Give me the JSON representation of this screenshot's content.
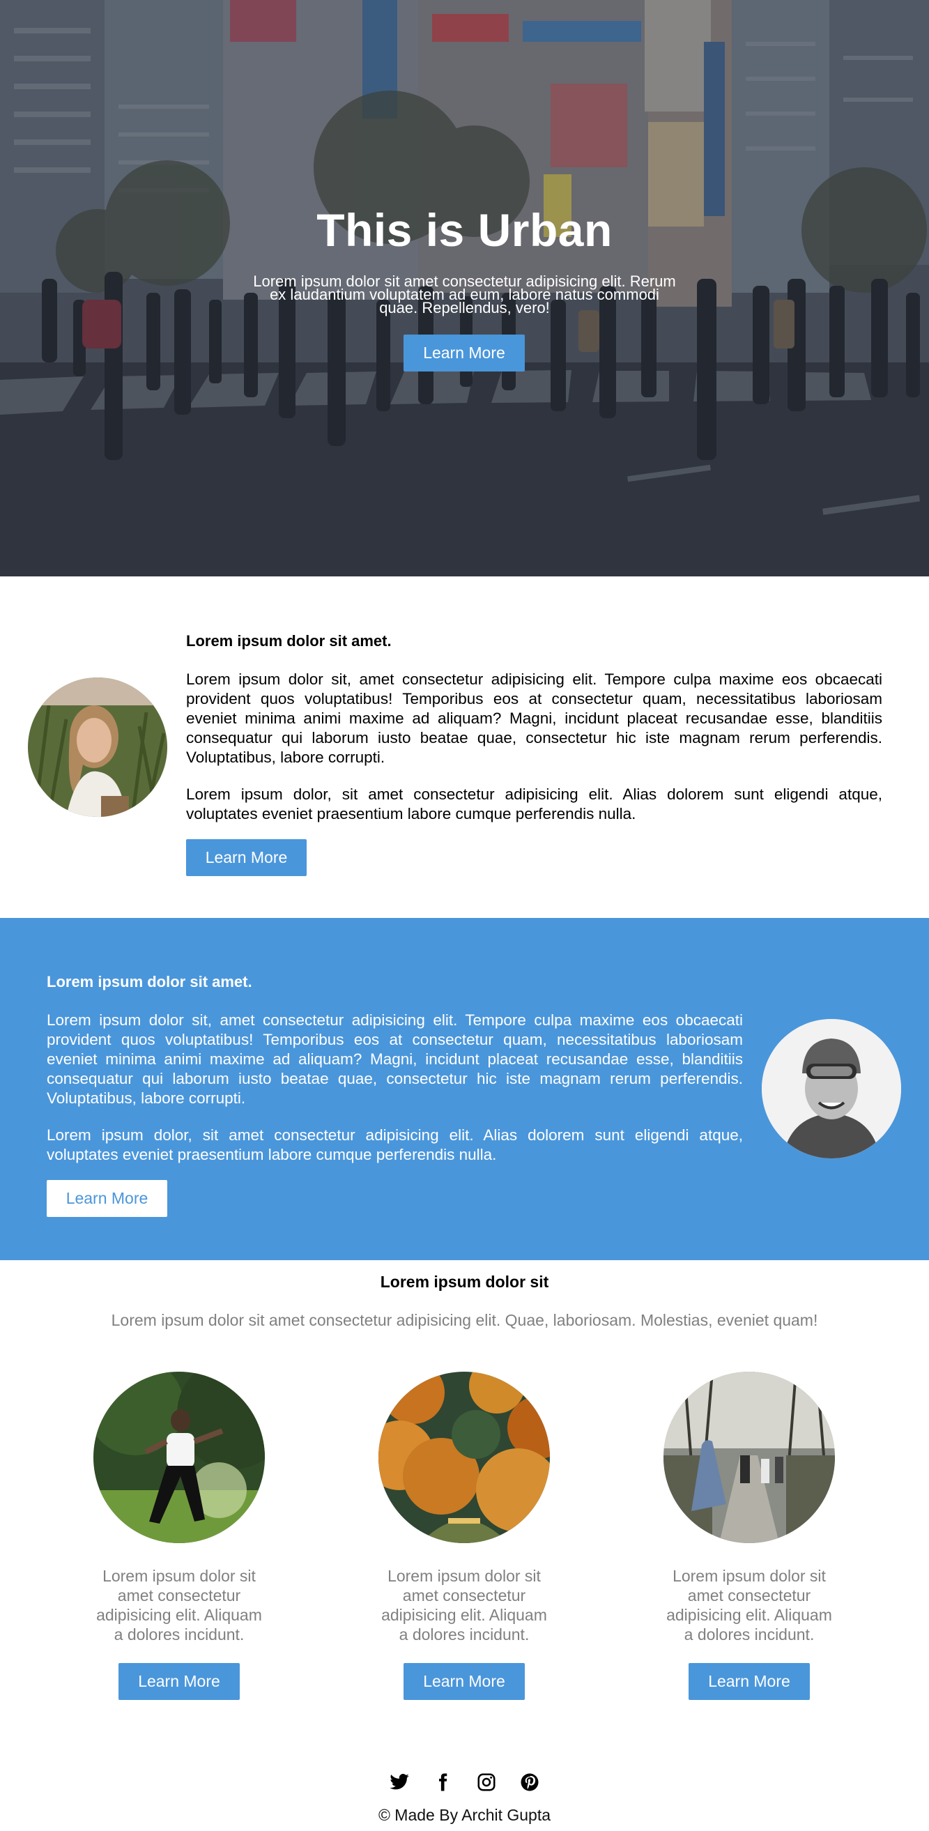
{
  "hero": {
    "title": "This is Urban",
    "text": "Lorem ipsum dolor sit amet consectetur adipisicing elit. Rerum ex laudantium voluptatem ad eum, labore natus commodi quae. Repellendus, vero!",
    "button": "Learn More"
  },
  "section1": {
    "heading": "Lorem ipsum dolor sit amet.",
    "para1": "Lorem ipsum dolor sit, amet consectetur adipisicing elit. Tempore culpa maxime eos obcaecati provident quos voluptatibus! Temporibus eos at consectetur quam, necessitatibus laboriosam eveniet minima animi maxime ad aliquam? Magni, incidunt placeat recusandae esse, blanditiis consequatur qui laborum iusto beatae quae, consectetur hic iste magnam rerum perferendis. Voluptatibus, labore corrupti.",
    "para2": "Lorem ipsum dolor, sit amet consectetur adipisicing elit. Alias dolorem sunt eligendi atque, voluptates eveniet praesentium labore cumque perferendis nulla.",
    "button": "Learn More"
  },
  "section2": {
    "heading": "Lorem ipsum dolor sit amet.",
    "para1": "Lorem ipsum dolor sit, amet consectetur adipisicing elit. Tempore culpa maxime eos obcaecati provident quos voluptatibus! Temporibus eos at consectetur quam, necessitatibus laboriosam eveniet minima animi maxime ad aliquam? Magni, incidunt placeat recusandae esse, blanditiis consequatur qui laborum iusto beatae quae, consectetur hic iste magnam rerum perferendis. Voluptatibus, labore corrupti.",
    "para2": "Lorem ipsum dolor, sit amet consectetur adipisicing elit. Alias dolorem sunt eligendi atque, voluptates eveniet praesentium labore cumque perferendis nulla.",
    "button": "Learn More"
  },
  "section3": {
    "title": "Lorem ipsum dolor sit",
    "subtitle": "Lorem ipsum dolor sit amet consectetur adipisicing elit. Quae, laboriosam. Molestias, eveniet quam!",
    "cards": [
      {
        "text": "Lorem ipsum dolor sit amet consectetur adipisicing elit. Aliquam a dolores incidunt.",
        "button": "Learn More"
      },
      {
        "text": "Lorem ipsum dolor sit amet consectetur adipisicing elit. Aliquam a dolores incidunt.",
        "button": "Learn More"
      },
      {
        "text": "Lorem ipsum dolor sit amet consectetur adipisicing elit. Aliquam a dolores incidunt.",
        "button": "Learn More"
      }
    ]
  },
  "social": [
    "twitter-icon",
    "facebook-icon",
    "instagram-icon",
    "pinterest-icon"
  ],
  "footer": "© Made By Archit Gupta",
  "colors": {
    "accent": "#4a96db",
    "muted_text": "#808080",
    "white": "#ffffff"
  }
}
